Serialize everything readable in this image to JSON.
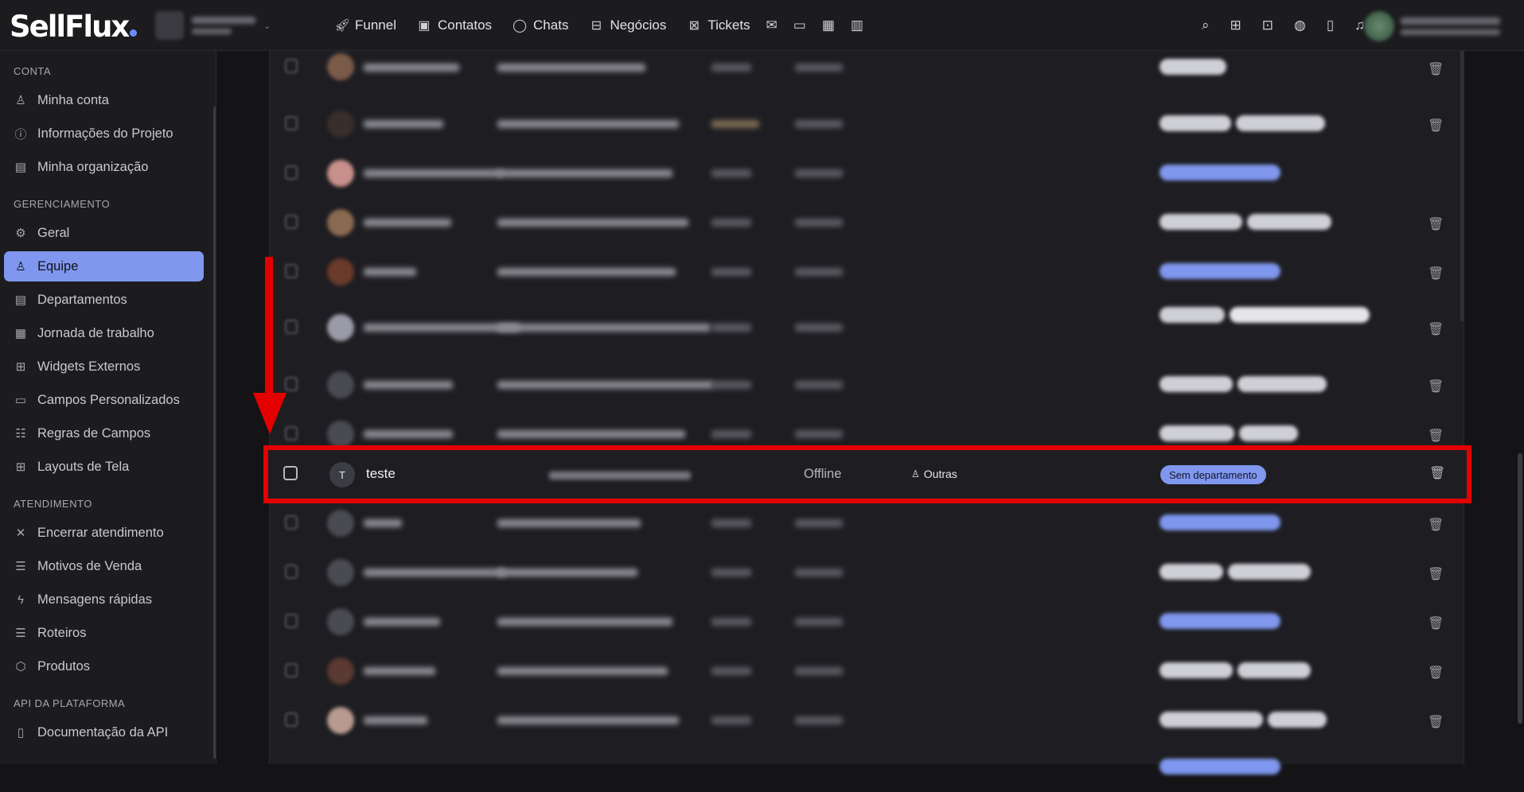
{
  "app": {
    "logo": "SellFlux"
  },
  "nav": {
    "items": [
      {
        "label": "Funnel",
        "icon": "rocket-icon"
      },
      {
        "label": "Contatos",
        "icon": "contacts-icon"
      },
      {
        "label": "Chats",
        "icon": "chat-bubble-icon"
      },
      {
        "label": "Negócios",
        "icon": "briefcase-icon"
      },
      {
        "label": "Tickets",
        "icon": "ticket-icon"
      }
    ],
    "extra_icons": [
      "mail-icon",
      "message-square-icon",
      "calendar-icon",
      "bar-chart-icon"
    ],
    "right_icons": [
      "search-icon",
      "grid-icon",
      "inbox-icon",
      "globe-icon",
      "book-icon",
      "headset-icon"
    ]
  },
  "sidebar": {
    "sections": [
      {
        "title": "CONTA",
        "items": [
          {
            "label": "Minha conta",
            "icon": "user-icon"
          },
          {
            "label": "Informações do Projeto",
            "icon": "info-icon"
          },
          {
            "label": "Minha organização",
            "icon": "building-icon"
          }
        ]
      },
      {
        "title": "GERENCIAMENTO",
        "items": [
          {
            "label": "Geral",
            "icon": "gear-icon"
          },
          {
            "label": "Equipe",
            "icon": "users-icon",
            "active": true
          },
          {
            "label": "Departamentos",
            "icon": "building-icon"
          },
          {
            "label": "Jornada de trabalho",
            "icon": "calendar-icon"
          },
          {
            "label": "Widgets Externos",
            "icon": "widgets-icon"
          },
          {
            "label": "Campos Personalizados",
            "icon": "field-icon"
          },
          {
            "label": "Regras de Campos",
            "icon": "rules-icon"
          },
          {
            "label": "Layouts de Tela",
            "icon": "layout-icon"
          }
        ]
      },
      {
        "title": "ATENDIMENTO",
        "items": [
          {
            "label": "Encerrar atendimento",
            "icon": "close-icon"
          },
          {
            "label": "Motivos de Venda",
            "icon": "checklist-icon"
          },
          {
            "label": "Mensagens rápidas",
            "icon": "lightning-icon"
          },
          {
            "label": "Roteiros",
            "icon": "list-icon"
          },
          {
            "label": "Produtos",
            "icon": "box-icon"
          }
        ]
      },
      {
        "title": "API DA PLATAFORMA",
        "items": [
          {
            "label": "Documentação da API",
            "icon": "book-icon"
          }
        ]
      }
    ]
  },
  "highlighted_member": {
    "avatar_initial": "T",
    "name": "teste",
    "status": "Offline",
    "role": "Outras",
    "department": "Sem departamento"
  },
  "colors": {
    "accent": "#7f97ee",
    "highlight": "#e40000"
  }
}
